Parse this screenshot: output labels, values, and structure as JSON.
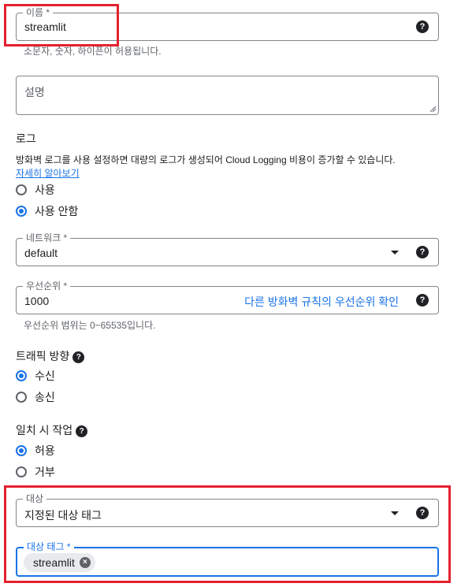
{
  "name_field": {
    "label": "이름 *",
    "value": "streamlit",
    "hint": "소문자, 숫자, 하이픈이 허용됩니다."
  },
  "description_field": {
    "placeholder": "설명"
  },
  "logs": {
    "title": "로그",
    "description": "방화벽 로그를 사용 설정하면 대량의 로그가 생성되어 Cloud Logging 비용이 증가할 수 있습니다.",
    "learn_more": "자세히 알아보기",
    "options": [
      {
        "label": "사용",
        "checked": false
      },
      {
        "label": "사용 안함",
        "checked": true
      }
    ]
  },
  "network_field": {
    "label": "네트워크 *",
    "value": "default"
  },
  "priority_field": {
    "label": "우선순위 *",
    "value": "1000",
    "link": "다른 방화벽 규칙의 우선순위 확인",
    "hint": "우선순위 범위는 0~65535입니다."
  },
  "traffic_direction": {
    "title": "트래픽 방향",
    "options": [
      {
        "label": "수신",
        "checked": true
      },
      {
        "label": "송신",
        "checked": false
      }
    ]
  },
  "action_on_match": {
    "title": "일치 시 작업",
    "options": [
      {
        "label": "허용",
        "checked": true
      },
      {
        "label": "거부",
        "checked": false
      }
    ]
  },
  "targets_field": {
    "label": "대상",
    "value": "지정된 대상 태그"
  },
  "target_tags_field": {
    "label": "대상 태그 *",
    "chips": [
      "streamlit"
    ]
  },
  "icons": {
    "help": "?",
    "chip_remove": "×"
  },
  "colors": {
    "accent": "#1a73e8",
    "highlight": "#e5202e",
    "border": "#80868b"
  }
}
